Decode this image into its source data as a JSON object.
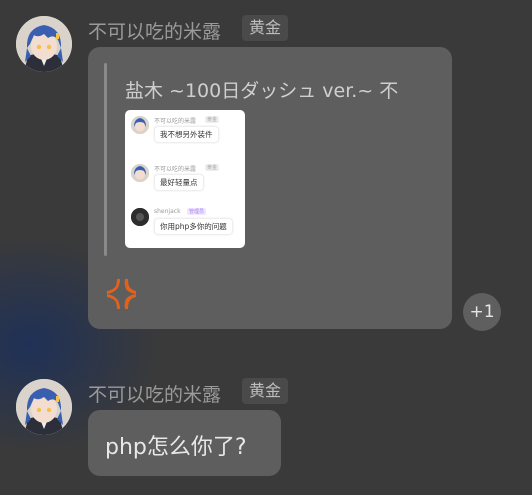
{
  "messages": [
    {
      "sender": "不可以吃的米露",
      "badge": "黄金",
      "quote": {
        "title": "盐木 ~100日ダッシュ ver.~ 不",
        "screenshot": [
          {
            "name": "不可以吃的米露",
            "badge": "黄金",
            "text": "我不想另外装件"
          },
          {
            "name": "不可以吃的米露",
            "badge": "黄金",
            "text": "最好轻量点"
          },
          {
            "name": "shenjack",
            "badge": "管理员",
            "text": "你用php多你的问题"
          }
        ]
      },
      "reaction": {
        "icon": "anger-icon",
        "count": "+1"
      }
    },
    {
      "sender": "不可以吃的米露",
      "badge": "黄金",
      "text": "php怎么你了?"
    }
  ],
  "colors": {
    "background": "#3a3a3a",
    "bubble": "#5e5e5e",
    "reaction": "#e2621b",
    "admin_badge": "#a884f0"
  }
}
